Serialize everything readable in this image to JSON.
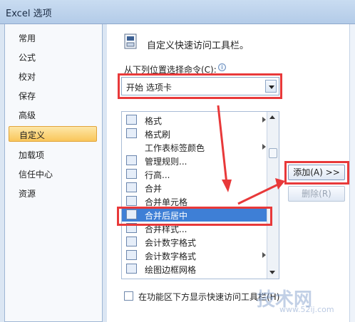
{
  "window": {
    "title": "Excel 选项"
  },
  "nav": {
    "items": [
      {
        "label": "常用"
      },
      {
        "label": "公式"
      },
      {
        "label": "校对"
      },
      {
        "label": "保存"
      },
      {
        "label": "高级"
      },
      {
        "label": "自定义"
      },
      {
        "label": "加载项"
      },
      {
        "label": "信任中心"
      },
      {
        "label": "资源"
      }
    ],
    "active_index": 5
  },
  "main": {
    "heading": "自定义快速访问工具栏。",
    "choose_label": "从下列位置选择命令(C):",
    "info_glyph": "i",
    "dropdown_value": "开始 选项卡",
    "commands": [
      {
        "label": "格式",
        "icon": "format-icon",
        "has_submenu": true
      },
      {
        "label": "格式刷",
        "icon": "format-painter-icon",
        "has_submenu": false
      },
      {
        "label": "工作表标签颜色",
        "icon": "",
        "has_submenu": true
      },
      {
        "label": "管理规则...",
        "icon": "manage-rules-icon",
        "has_submenu": false
      },
      {
        "label": "行高...",
        "icon": "row-height-icon",
        "has_submenu": false
      },
      {
        "label": "合并",
        "icon": "merge-icon",
        "has_submenu": false
      },
      {
        "label": "合并单元格",
        "icon": "merge-cells-icon",
        "has_submenu": false
      },
      {
        "label": "合并后居中",
        "icon": "merge-center-icon",
        "has_submenu": false
      },
      {
        "label": "合并样式...",
        "icon": "merge-styles-icon",
        "has_submenu": false
      },
      {
        "label": "会计数字格式",
        "icon": "accounting-format-icon",
        "has_submenu": false
      },
      {
        "label": "会计数字格式",
        "icon": "accounting-format-icon",
        "has_submenu": true
      },
      {
        "label": "绘图边框网格",
        "icon": "draw-border-grid-icon",
        "has_submenu": false
      }
    ],
    "selected_index": 7,
    "add_button": "添加(A) >>",
    "remove_button": "删除(R)",
    "checkbox_label": "在功能区下方显示快速访问工具栏(H)"
  },
  "watermark": {
    "text": "技术网",
    "url_text": "www.52ij.com"
  },
  "colors": {
    "highlight_red": "#e8393a",
    "selection_blue": "#3e7fd6",
    "active_nav": "#f9c65a"
  }
}
